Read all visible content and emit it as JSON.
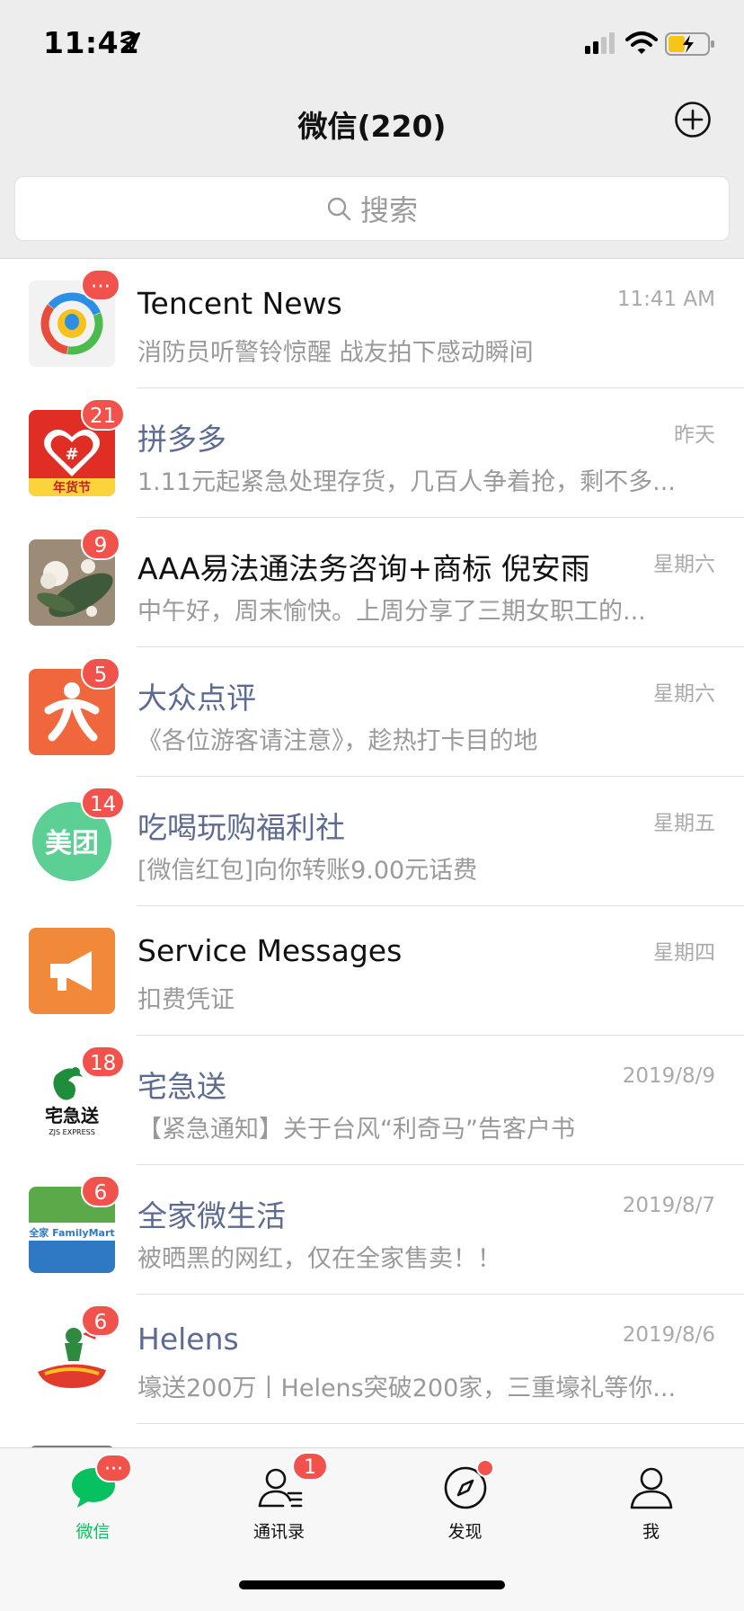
{
  "status_bar": {
    "time": "11:42"
  },
  "nav": {
    "title": "微信(220)"
  },
  "search": {
    "placeholder": "搜索"
  },
  "chats": [
    {
      "name": "Tencent News",
      "time": "11:41 AM",
      "preview": "消防员听警铃惊醒 战友拍下感动瞬间",
      "badge": "···",
      "avatar_icon": "tencent-news-logo",
      "name_style": "normal"
    },
    {
      "name": "拼多多",
      "time": "昨天",
      "preview": "1.11元起紧急处理存货，几百人争着抢，剩不多...",
      "badge": "21",
      "avatar_icon": "pinduoduo-logo",
      "avatar_caption": "年货节",
      "name_style": "official"
    },
    {
      "name": "AAA易法通法务咨询+商标 倪安雨",
      "time": "星期六",
      "preview": " 中午好，周末愉快。上周分享了三期女职工的...",
      "badge": "9",
      "avatar_icon": "cotton-flower-photo",
      "name_style": "normal"
    },
    {
      "name": "大众点评",
      "time": "星期六",
      "preview": "《各位游客请注意》，趁热打卡目的地",
      "badge": "5",
      "avatar_icon": "dianping-logo",
      "name_style": "official"
    },
    {
      "name": "吃喝玩购福利社",
      "time": "星期五",
      "preview": "[微信红包]向你转账9.00元话费",
      "badge": "14",
      "avatar_icon": "meituan-logo",
      "avatar_text": "美团",
      "name_style": "official"
    },
    {
      "name": "Service Messages",
      "time": "星期四",
      "preview": "扣费凭证",
      "badge": "",
      "avatar_icon": "megaphone-icon",
      "name_style": "normal"
    },
    {
      "name": "宅急送",
      "time": "2019/8/9",
      "preview": "【紧急通知】关于台风“利奇马”告客户书",
      "badge": "18",
      "avatar_icon": "zjs-express-logo",
      "avatar_text": "宅急送",
      "avatar_sub": "ZJS EXPRESS",
      "name_style": "official"
    },
    {
      "name": "全家微生活",
      "time": "2019/8/7",
      "preview": "被晒黑的网红，仅在全家售卖！！",
      "badge": "6",
      "avatar_icon": "familymart-logo",
      "avatar_text": "全家 FamilyMart",
      "name_style": "official"
    },
    {
      "name": "Helens",
      "time": "2019/8/6",
      "preview": "壕送200万丨Helens突破200家，三重壕礼等你...",
      "badge": "6",
      "avatar_icon": "helens-logo",
      "name_style": "official"
    }
  ],
  "tabs": [
    {
      "label": "微信",
      "badge": "···",
      "icon": "chat-bubble-icon",
      "active": true
    },
    {
      "label": "通讯录",
      "badge": "1",
      "icon": "contacts-icon",
      "active": false
    },
    {
      "label": "发现",
      "badge": "",
      "dot": true,
      "icon": "compass-icon",
      "active": false
    },
    {
      "label": "我",
      "badge": "",
      "icon": "person-icon",
      "active": false
    }
  ],
  "colors": {
    "accent_green": "#07c160",
    "badge_red": "#f2524c",
    "official_name": "#5d6b93"
  }
}
